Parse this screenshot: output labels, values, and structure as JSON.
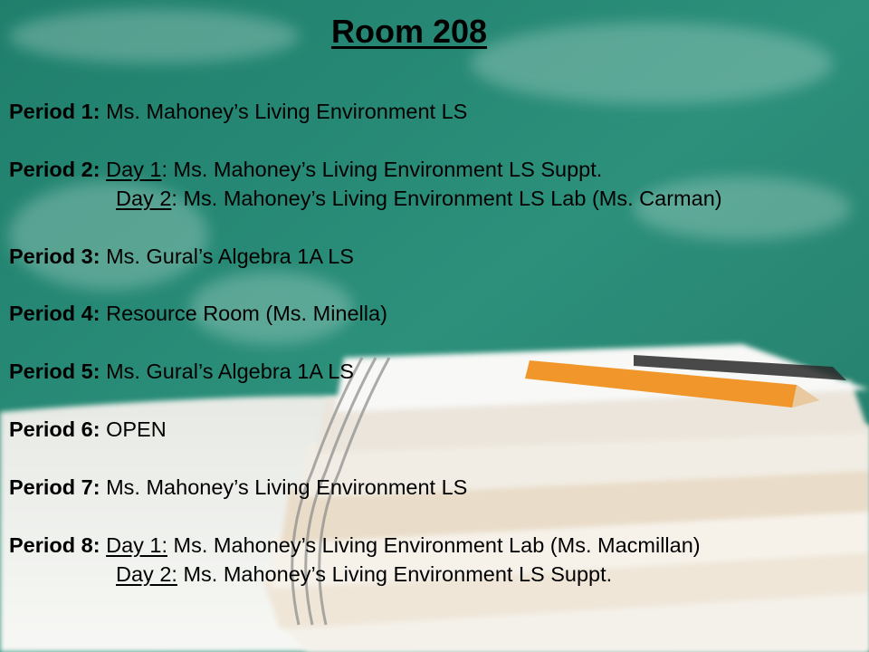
{
  "title": "Room 208",
  "periods": [
    {
      "label": "Period 1:",
      "text": " Ms. Mahoney’s Living Environment LS"
    },
    {
      "label": "Period 2:",
      "day1": "Day 1",
      "day1_text": ": Ms. Mahoney’s Living Environment LS Suppt.",
      "day2": "Day 2",
      "day2_text": ":  Ms. Mahoney’s Living Environment LS Lab (Ms. Carman)"
    },
    {
      "label": "Period 3:",
      "text": "  Ms. Gural’s Algebra 1A LS"
    },
    {
      "label": "Period 4:",
      "text": " Resource Room (Ms. Minella)"
    },
    {
      "label": "Period 5:",
      "text": " Ms. Gural’s Algebra 1A LS"
    },
    {
      "label": "Period 6:",
      "text": " OPEN"
    },
    {
      "label": "Period 7:",
      "text": " Ms. Mahoney’s Living Environment LS"
    },
    {
      "label": "Period 8:",
      "day1": "Day 1:",
      "day1_text": " Ms. Mahoney’s Living Environment Lab (Ms. Macmillan)",
      "day2": "Day 2:",
      "day2_text": " Ms. Mahoney’s Living Environment LS Suppt."
    }
  ]
}
